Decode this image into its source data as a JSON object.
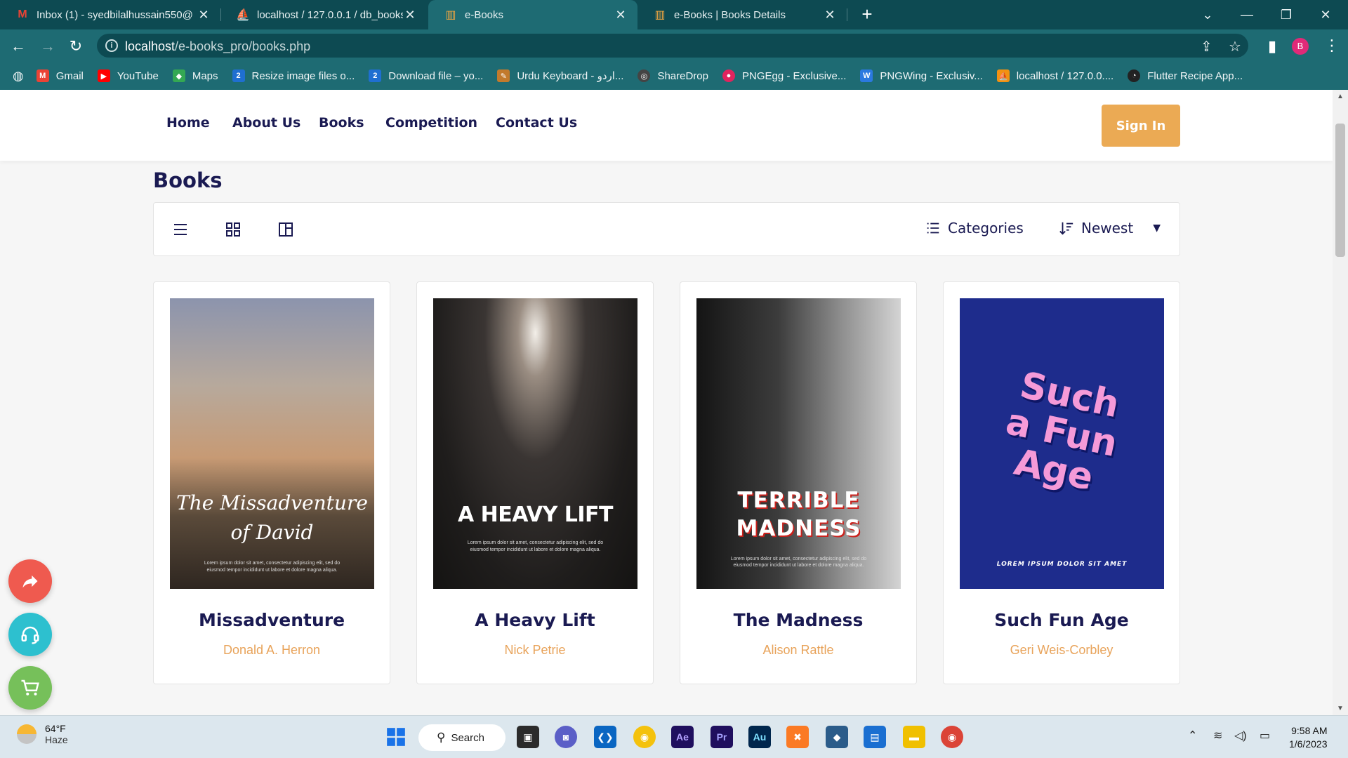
{
  "browser": {
    "tabs": [
      {
        "title": "Inbox (1) - syedbilalhussain550@",
        "icon": "gmail-icon",
        "active": false
      },
      {
        "title": "localhost / 127.0.0.1 / db_books /",
        "icon": "phpmyadmin-icon",
        "active": false
      },
      {
        "title": "e-Books",
        "icon": "books-icon",
        "active": true
      },
      {
        "title": "e-Books | Books Details",
        "icon": "books-icon",
        "active": false
      }
    ],
    "url_host": "localhost",
    "url_path": "/e-books_pro/books.php",
    "profile_initial": "B",
    "bookmarks": [
      {
        "label": "Gmail",
        "icon": "gmail-icon",
        "color": "#ea4335"
      },
      {
        "label": "YouTube",
        "icon": "youtube-icon",
        "color": "#ff0000"
      },
      {
        "label": "Maps",
        "icon": "maps-icon",
        "color": "#34a853"
      },
      {
        "label": "Resize image files o...",
        "icon": "resize-icon",
        "color": "#1f6fd1"
      },
      {
        "label": "Download file – yo...",
        "icon": "download-icon",
        "color": "#1f6fd1"
      },
      {
        "label": "Urdu Keyboard - اردو...",
        "icon": "keyboard-icon",
        "color": "#c27a2c"
      },
      {
        "label": "ShareDrop",
        "icon": "sharedrop-icon",
        "color": "#444444"
      },
      {
        "label": "PNGEgg - Exclusive...",
        "icon": "pngegg-icon",
        "color": "#e0245e"
      },
      {
        "label": "PNGWing - Exclusiv...",
        "icon": "pngwing-icon",
        "color": "#2b79e0"
      },
      {
        "label": "localhost / 127.0.0....",
        "icon": "phpmyadmin-icon",
        "color": "#f29111"
      },
      {
        "label": "Flutter Recipe App...",
        "icon": "flutter-icon",
        "color": "#222222"
      }
    ]
  },
  "site": {
    "nav": [
      "Home",
      "About Us",
      "Books",
      "Competition",
      "Contact Us"
    ],
    "sign_in": "Sign In",
    "page_title": "Books",
    "toolbar": {
      "categories": "Categories",
      "sort": "Newest"
    },
    "books": [
      {
        "title": "Missadventure",
        "author": "Donald A. Herron",
        "cover_text": "The Missadventure of David",
        "cover_small": "Lorem ipsum dolor sit amet, consectetur adipiscing elit, sed do eiusmod tempor incididunt ut labore et dolore magna aliqua."
      },
      {
        "title": "A Heavy Lift",
        "author": "Nick Petrie",
        "cover_text": "A HEAVY LIFT",
        "cover_small": "Lorem ipsum dolor sit amet, consectetur adipiscing elit, sed do eiusmod tempor incididunt ut labore et dolore magna aliqua."
      },
      {
        "title": "The Madness",
        "author": "Alison Rattle",
        "cover_text_1": "TERRIBLE",
        "cover_text_2": "MADNESS",
        "cover_small": "Lorem ipsum dolor sit amet, consectetur adipiscing elit, sed do eiusmod tempor incididunt ut labore et dolore magna aliqua."
      },
      {
        "title": "Such Fun Age",
        "author": "Geri Weis-Corbley",
        "cover_text_1": "Such",
        "cover_text_2": "a Fun",
        "cover_text_3": "Age",
        "cover_small": "LOREM IPSUM DOLOR SIT AMET"
      }
    ]
  },
  "taskbar": {
    "temperature": "64°F",
    "weather": "Haze",
    "search": "Search",
    "time": "9:58 AM",
    "date": "1/6/2023"
  },
  "colors": {
    "accent": "#ebaa54",
    "navy": "#1a1a52",
    "author": "#e8a35a",
    "browser_dark": "#0d4a52",
    "browser": "#1e6b73"
  }
}
